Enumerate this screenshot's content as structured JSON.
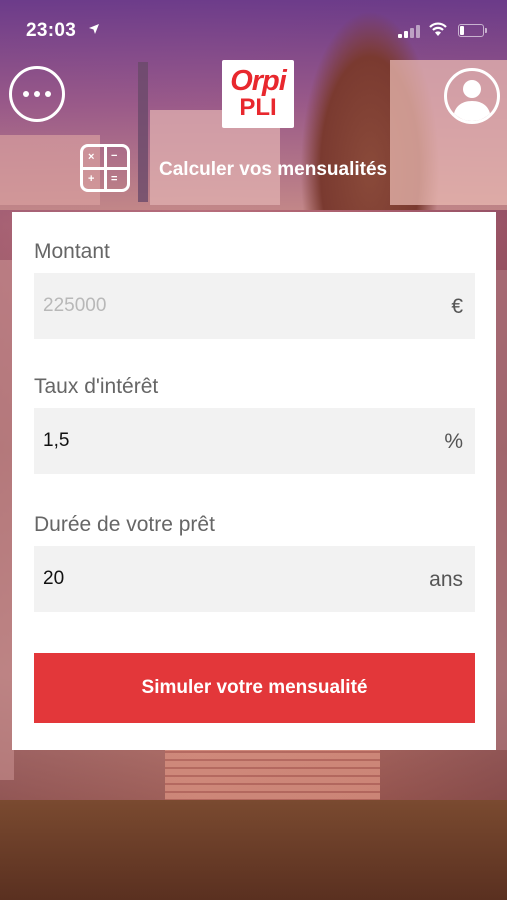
{
  "status_bar": {
    "time": "23:03",
    "location_icon": "location-arrow-icon",
    "signal_icon": "cellular-signal-icon",
    "wifi_icon": "wifi-icon",
    "battery_icon": "battery-icon",
    "battery_level": 0.2
  },
  "header": {
    "menu_icon": "more-dots-icon",
    "logo_line1": "Orpi",
    "logo_line2": "PLI",
    "profile_icon": "user-silhouette-icon"
  },
  "section": {
    "icon": "calculator-icon",
    "title": "Calculer vos mensualités"
  },
  "form": {
    "amount": {
      "label": "Montant",
      "value": "",
      "placeholder": "225000",
      "unit": "€"
    },
    "rate": {
      "label": "Taux d'intérêt",
      "value": "1,5",
      "placeholder": "",
      "unit": "%"
    },
    "duration": {
      "label": "Durée de votre prêt",
      "value": "20",
      "placeholder": "",
      "unit": "ans"
    },
    "submit_label": "Simuler votre mensualité"
  },
  "colors": {
    "accent": "#e3373a",
    "logo_red": "#e8282e",
    "field_bg": "#f2f2f2"
  }
}
